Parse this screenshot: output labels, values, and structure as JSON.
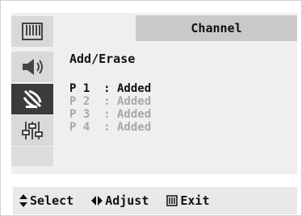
{
  "menu": {
    "title": "Channel",
    "subtitle": "Add/Erase",
    "sidebar_icons": [
      "picture-icon",
      "sound-icon",
      "channel-antenna-icon",
      "setup-sliders-icon"
    ],
    "programs": [
      {
        "row": "P 1  : Added",
        "selected": true
      },
      {
        "row": "P 2  : Added",
        "selected": false
      },
      {
        "row": "P 3  : Added",
        "selected": false
      },
      {
        "row": "P 4  : Added",
        "selected": false
      }
    ]
  },
  "footer": {
    "select_label": "Select",
    "adjust_label": "Adjust",
    "exit_label": "Exit"
  }
}
